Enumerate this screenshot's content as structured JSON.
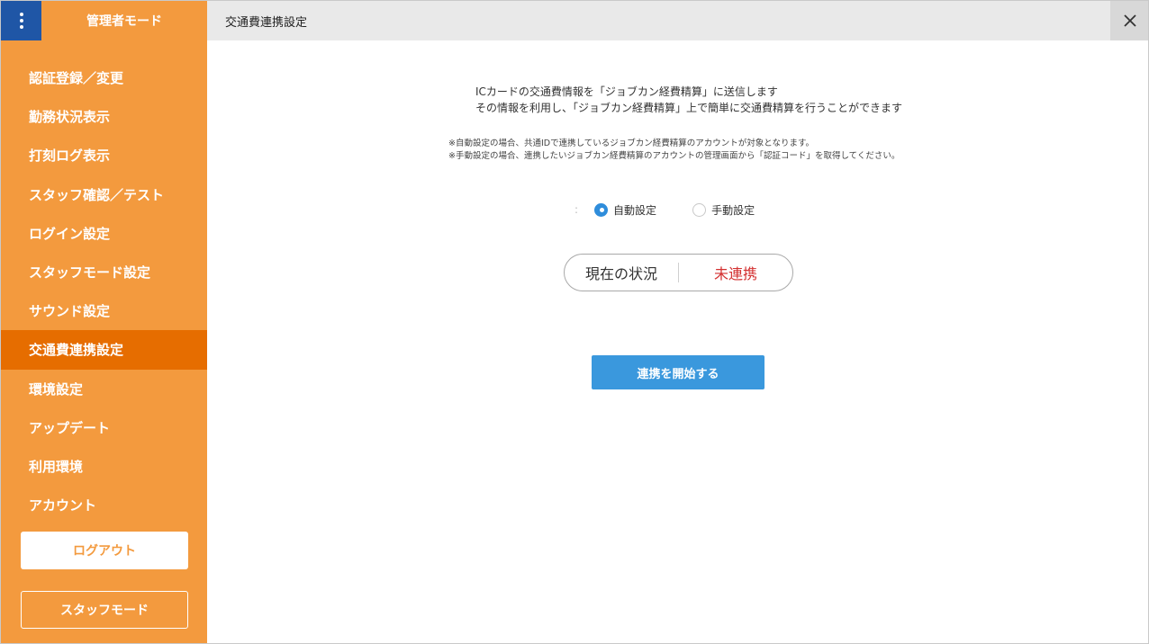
{
  "sidebar": {
    "title": "管理者モード",
    "items": [
      {
        "label": "認証登録／変更"
      },
      {
        "label": "勤務状況表示"
      },
      {
        "label": "打刻ログ表示"
      },
      {
        "label": "スタッフ確認／テスト"
      },
      {
        "label": "ログイン設定"
      },
      {
        "label": "スタッフモード設定"
      },
      {
        "label": "サウンド設定"
      },
      {
        "label": "交通費連携設定",
        "active": true
      },
      {
        "label": "環境設定"
      },
      {
        "label": "アップデート"
      },
      {
        "label": "利用環境"
      },
      {
        "label": "アカウント"
      }
    ],
    "logout_label": "ログアウト",
    "staff_mode_label": "スタッフモード"
  },
  "header": {
    "title": "交通費連携設定"
  },
  "main": {
    "description": [
      "ICカードの交通費情報を「ジョブカン経費精算」に送信します",
      "その情報を利用し、「ジョブカン経費精算」上で簡単に交通費精算を行うことができます"
    ],
    "notes": [
      "※自動設定の場合、共通IDで連携しているジョブカン経費精算のアカウントが対象となります。",
      "※手動設定の場合、連携したいジョブカン経費精算のアカウントの管理画面から「認証コード」を取得してください。"
    ],
    "radio_colon": ":",
    "radio_options": [
      {
        "label": "自動設定",
        "checked": true
      },
      {
        "label": "手動設定",
        "checked": false
      }
    ],
    "status_label": "現在の状況",
    "status_value": "未連携",
    "start_button": "連携を開始する"
  },
  "colors": {
    "sidebar": "#f39a3e",
    "sidebar_active": "#e66d00",
    "menu_button": "#1f56a6",
    "primary_button": "#3a98dd",
    "status_red": "#d32f2f"
  },
  "icons": {
    "menu": "vertical-dots-icon",
    "close": "close-icon"
  }
}
